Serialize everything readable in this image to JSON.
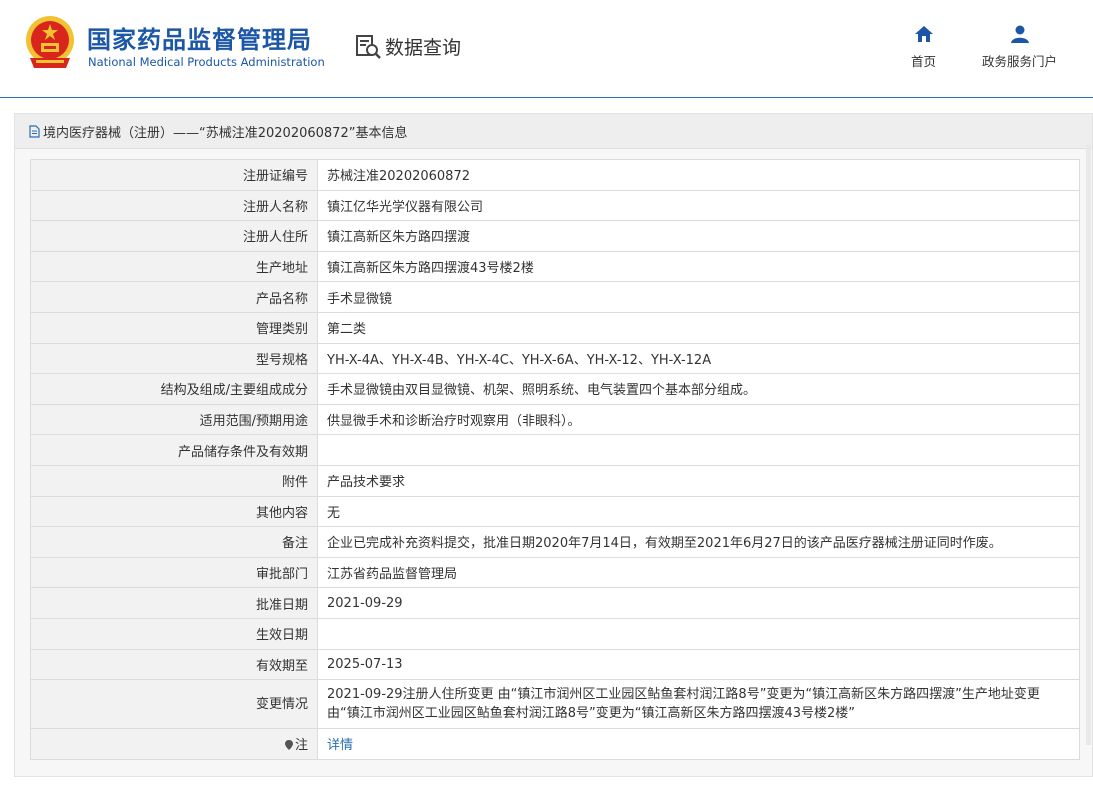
{
  "header": {
    "logo_cn": "国家药品监督管理局",
    "logo_en": "National Medical Products Administration",
    "query_label": "数据查询",
    "nav": [
      {
        "label": "首页",
        "icon": "home-icon"
      },
      {
        "label": "政务服务门户",
        "icon": "user-icon"
      }
    ]
  },
  "panel": {
    "title": "境内医疗器械（注册）——“苏械注准20202060872”基本信息"
  },
  "rows": [
    {
      "label": "注册证编号",
      "value": "苏械注准20202060872"
    },
    {
      "label": "注册人名称",
      "value": "镇江亿华光学仪器有限公司"
    },
    {
      "label": "注册人住所",
      "value": "镇江高新区朱方路四摆渡"
    },
    {
      "label": "生产地址",
      "value": "镇江高新区朱方路四摆渡43号楼2楼"
    },
    {
      "label": "产品名称",
      "value": "手术显微镜"
    },
    {
      "label": "管理类别",
      "value": "第二类"
    },
    {
      "label": "型号规格",
      "value": "YH-X-4A、YH-X-4B、YH-X-4C、YH-X-6A、YH-X-12、YH-X-12A"
    },
    {
      "label": "结构及组成/主要组成成分",
      "value": "手术显微镜由双目显微镜、机架、照明系统、电气装置四个基本部分组成。"
    },
    {
      "label": "适用范围/预期用途",
      "value": "供显微手术和诊断治疗时观察用（非眼科）。"
    },
    {
      "label": "产品储存条件及有效期",
      "value": ""
    },
    {
      "label": "附件",
      "value": "产品技术要求"
    },
    {
      "label": "其他内容",
      "value": "无"
    },
    {
      "label": "备注",
      "value": "企业已完成补充资料提交，批准日期2020年7月14日，有效期至2021年6月27日的该产品医疗器械注册证同时作废。"
    },
    {
      "label": "审批部门",
      "value": "江苏省药品监督管理局"
    },
    {
      "label": "批准日期",
      "value": "2021-09-29"
    },
    {
      "label": "生效日期",
      "value": ""
    },
    {
      "label": "有效期至",
      "value": "2025-07-13"
    },
    {
      "label": "变更情况",
      "value": "2021-09-29注册人住所变更 由“镇江市润州区工业园区鲇鱼套村润江路8号”变更为“镇江高新区朱方路四摆渡”生产地址变更 由“镇江市润州区工业园区鲇鱼套村润江路8号”变更为“镇江高新区朱方路四摆渡43号楼2楼”"
    },
    {
      "label": "注",
      "value": "详情"
    }
  ],
  "colors": {
    "brand_blue": "#1b57a6",
    "link_blue": "#2a6fb0",
    "emblem_red": "#d8261c",
    "emblem_gold": "#f3c232"
  }
}
